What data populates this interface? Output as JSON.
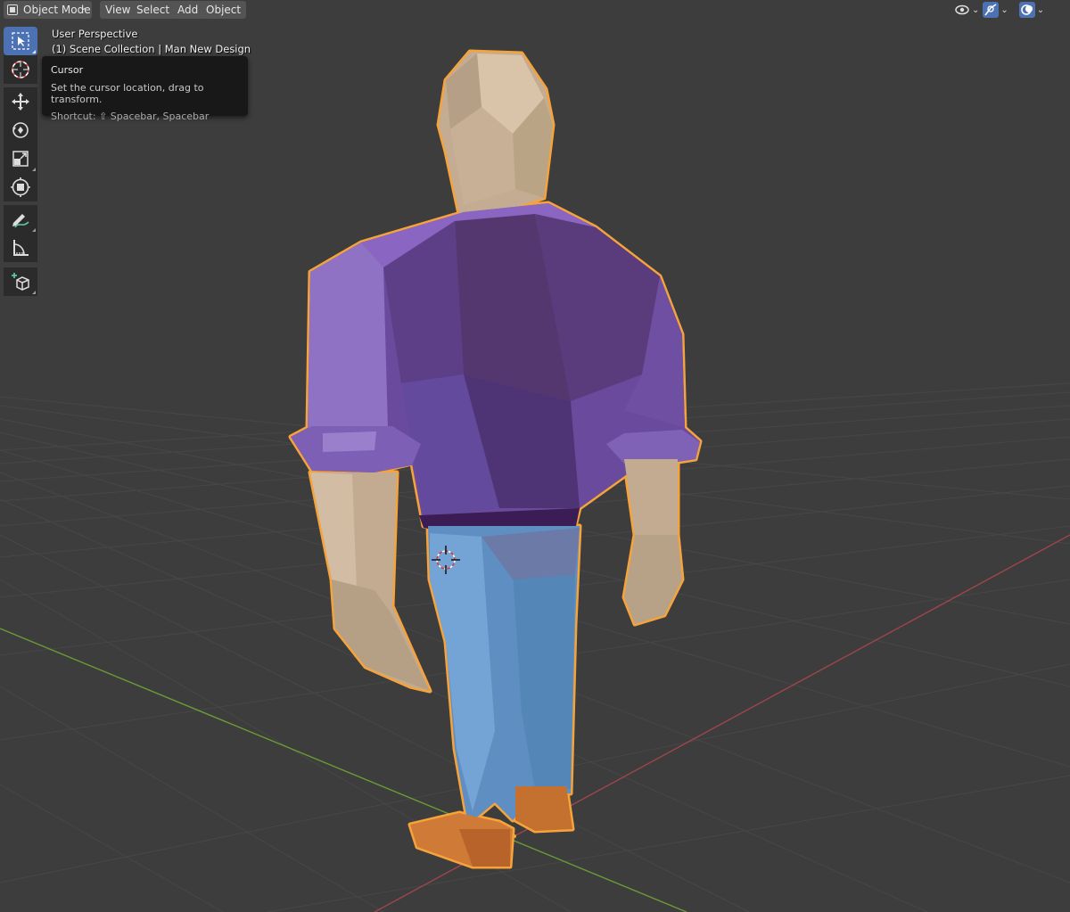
{
  "header": {
    "mode_label": "Object Mode",
    "menus": [
      "View",
      "Select",
      "Add",
      "Object"
    ],
    "right_icons": [
      "visibility-icon",
      "gizmo-icon",
      "overlay-icon"
    ]
  },
  "toolbar": {
    "tools": [
      {
        "name": "select-box",
        "icon": "select-box-icon",
        "active": true
      },
      {
        "name": "cursor",
        "icon": "cursor-icon",
        "active": false
      },
      {
        "name": "move",
        "icon": "move-icon",
        "active": false
      },
      {
        "name": "rotate",
        "icon": "rotate-icon",
        "active": false
      },
      {
        "name": "scale",
        "icon": "scale-icon",
        "active": false
      },
      {
        "name": "transform",
        "icon": "transform-icon",
        "active": false
      },
      {
        "name": "annotate",
        "icon": "annotate-icon",
        "active": false
      },
      {
        "name": "measure",
        "icon": "measure-icon",
        "active": false
      },
      {
        "name": "add-cube",
        "icon": "add-cube-icon",
        "active": false
      }
    ]
  },
  "viewport": {
    "perspective_label": "User Perspective",
    "collection_label": "(1) Scene Collection | Man New Design",
    "object": "low-poly-man-model"
  },
  "tooltip": {
    "title": "Cursor",
    "description": "Set the cursor location, drag to transform.",
    "shortcut": "Shortcut: ⇧ Spacebar, Spacebar"
  },
  "colors": {
    "background": "#3d3d3d",
    "grid": "#484848",
    "x_axis": "#a0454c",
    "y_axis": "#6c9a36",
    "selection_outline": "#f5a33a",
    "shirt": "#6a4a9c",
    "pants": "#5f8fc2",
    "skin": "#c4ac92",
    "shoes": "#d07a38",
    "active_tool": "#4d72b3"
  }
}
